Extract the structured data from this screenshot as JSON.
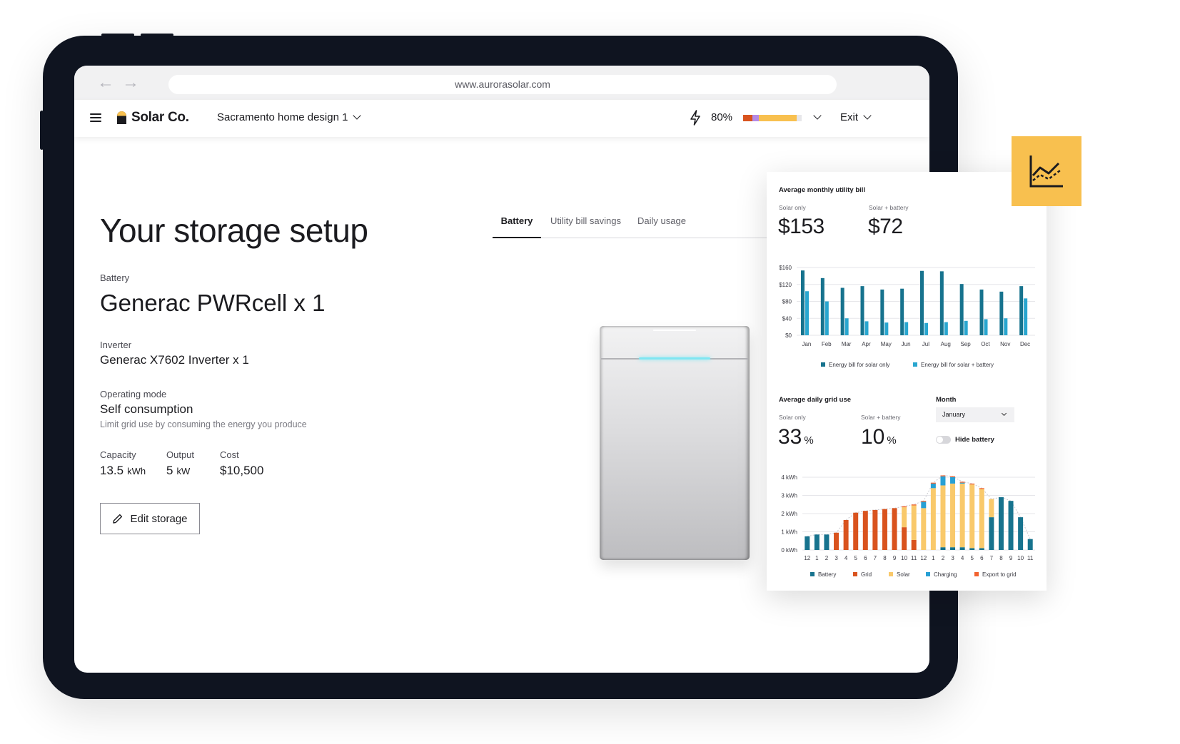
{
  "browser": {
    "url": "www.aurorasolar.com"
  },
  "app": {
    "brand": "Solar Co.",
    "project": "Sacramento home design 1",
    "progress_percent": "80%",
    "progress_segments": [
      0.16,
      0.11,
      0.64
    ],
    "exit_label": "Exit"
  },
  "page": {
    "title": "Your storage setup",
    "battery_label": "Battery",
    "battery_name": "Generac PWRcell x 1",
    "inverter_label": "Inverter",
    "inverter_name": "Generac X7602 Inverter x 1",
    "mode_label": "Operating mode",
    "mode_value": "Self consumption",
    "mode_desc": "Limit grid use by consuming the energy you produce",
    "capacity_label": "Capacity",
    "capacity_value": "13.5",
    "capacity_unit": "kWh",
    "output_label": "Output",
    "output_value": "5",
    "output_unit": "kW",
    "cost_label": "Cost",
    "cost_value": "$10,500",
    "edit_button": "Edit storage"
  },
  "tabs": [
    {
      "label": "Battery",
      "active": true
    },
    {
      "label": "Utility bill savings",
      "active": false
    },
    {
      "label": "Daily usage",
      "active": false
    }
  ],
  "colors": {
    "accent": "#f8c04f",
    "dark_teal": "#17738e",
    "light_teal": "#29a6cf",
    "grid": "#d9531e",
    "solar": "#f9c96b",
    "charging": "#28a0d4",
    "export": "#f2622f",
    "frame": "#0f1420"
  },
  "card": {
    "bill_title": "Average monthly utility bill",
    "solar_only_label": "Solar only",
    "solar_battery_label": "Solar + battery",
    "solar_only_bill": "$153",
    "solar_battery_bill": "$72",
    "grid_title": "Average daily grid use",
    "grid_solar_only": "33",
    "grid_solar_battery": "10",
    "pct_sign": "%",
    "month_label": "Month",
    "month_value": "January",
    "hide_battery": "Hide battery"
  },
  "chart_data": [
    {
      "type": "bar",
      "title": "Average monthly utility bill",
      "categories": [
        "Jan",
        "Feb",
        "Mar",
        "Apr",
        "May",
        "Jun",
        "Jul",
        "Aug",
        "Sep",
        "Oct",
        "Nov",
        "Dec"
      ],
      "series": [
        {
          "name": "Energy bill for solar only",
          "values": [
            153,
            135,
            112,
            116,
            108,
            110,
            152,
            151,
            121,
            108,
            103,
            116
          ]
        },
        {
          "name": "Energy bill for solar + battery",
          "values": [
            104,
            80,
            40,
            33,
            30,
            31,
            29,
            31,
            34,
            38,
            40,
            87
          ]
        }
      ],
      "ylim": [
        0,
        160
      ],
      "yticks": [
        "$0",
        "$40",
        "$80",
        "$120",
        "$160"
      ],
      "ytick_values": [
        0,
        40,
        80,
        120,
        160
      ],
      "legend": "bottom"
    },
    {
      "type": "bar",
      "stacked": true,
      "categories": [
        "12",
        "1",
        "2",
        "3",
        "4",
        "5",
        "6",
        "7",
        "8",
        "9",
        "10",
        "11",
        "12",
        "1",
        "2",
        "3",
        "4",
        "5",
        "6",
        "7",
        "8",
        "9",
        "10",
        "11"
      ],
      "series": [
        {
          "name": "Battery",
          "values": [
            0.75,
            0.85,
            0.85,
            0,
            0,
            0,
            0,
            0,
            0,
            0,
            0,
            0,
            0,
            0,
            0.15,
            0.15,
            0.15,
            0.1,
            0.1,
            1.8,
            2.9,
            2.7,
            1.8,
            0.6
          ]
        },
        {
          "name": "Grid",
          "values": [
            0,
            0,
            0,
            0.95,
            1.65,
            2.05,
            2.15,
            2.2,
            2.25,
            2.3,
            1.25,
            0.55,
            0,
            0,
            0,
            0,
            0,
            0,
            0,
            0,
            0,
            0,
            0,
            0
          ]
        },
        {
          "name": "Solar",
          "values": [
            0,
            0,
            0,
            0,
            0,
            0,
            0,
            0,
            0,
            0,
            1.1,
            1.9,
            2.3,
            3.4,
            3.4,
            3.5,
            3.5,
            3.5,
            3.25,
            1.0,
            0,
            0,
            0,
            0
          ]
        },
        {
          "name": "Charging",
          "values": [
            0,
            0,
            0,
            0,
            0,
            0,
            0,
            0,
            0,
            0,
            0,
            0,
            0.35,
            0.25,
            0.5,
            0.35,
            0.05,
            0,
            0,
            0,
            0,
            0,
            0,
            0
          ]
        },
        {
          "name": "Export to grid",
          "values": [
            0,
            0,
            0,
            0,
            0,
            0,
            0,
            0,
            0,
            0,
            0.05,
            0.05,
            0.05,
            0.05,
            0.05,
            0.05,
            0.05,
            0.05,
            0.05,
            0,
            0,
            0,
            0,
            0
          ]
        }
      ],
      "ylim": [
        0,
        4
      ],
      "yticks": [
        "0 kWh",
        "1 kWh",
        "2 kWh",
        "3 kWh",
        "4 kWh"
      ],
      "ytick_values": [
        0,
        1,
        2,
        3,
        4
      ],
      "legend": "bottom"
    }
  ]
}
